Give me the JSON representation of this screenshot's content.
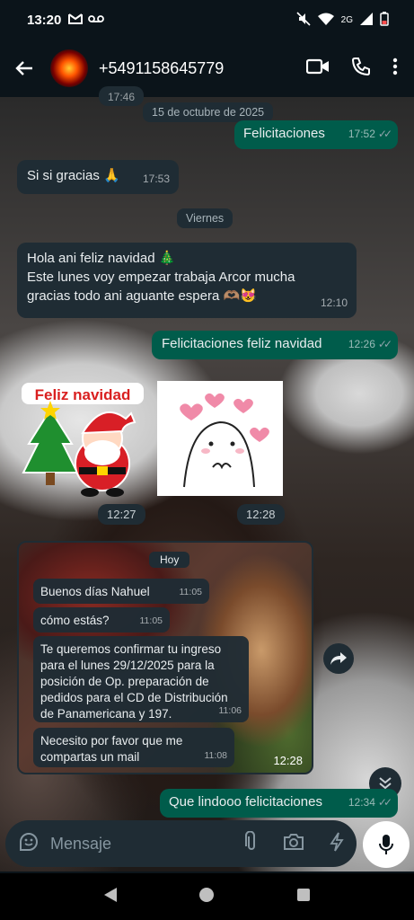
{
  "status_bar": {
    "time": "13:20",
    "network": "2G"
  },
  "header": {
    "contact": "+5491158645779"
  },
  "partial_time": "17:46",
  "date_chips": {
    "d1": "15 de octubre de 2025",
    "d2": "Viernes"
  },
  "messages": {
    "m1": {
      "text": "Felicitaciones",
      "time": "17:52"
    },
    "m2": {
      "text": "Si si gracias 🙏",
      "time": "17:53"
    },
    "m3": {
      "line1": "Hola ani feliz navidad 🎄",
      "line2": "Este lunes voy empezar trabaja Arcor mucha",
      "line3": "gracias todo ani aguante espera 🫶🏽😻",
      "time": "12:10"
    },
    "m4": {
      "text": "Felicitaciones feliz navidad",
      "time": "12:26"
    },
    "sticker1": {
      "caption": "Feliz navidad",
      "time": "12:27"
    },
    "sticker2": {
      "time": "12:28"
    },
    "forwarded": {
      "chip": "Hoy",
      "b1": {
        "text": "Buenos días Nahuel",
        "time": "11:05"
      },
      "b2": {
        "text": "cómo estás?",
        "time": "11:05"
      },
      "b3": {
        "l1": "Te queremos confirmar tu ingreso",
        "l2": "para el lunes 29/12/2025 para la",
        "l3": "posición de Op. preparación de",
        "l4": "pedidos para el CD de Distribución",
        "l5": "de Panamericana y 197.",
        "time": "11:06"
      },
      "b4": {
        "l1": "Necesito por favor que me",
        "l2": "compartas un mail",
        "time": "11:08"
      },
      "time": "12:28"
    },
    "m5": {
      "text": "Que lindooo felicitaciones",
      "time": "12:34"
    }
  },
  "composer": {
    "placeholder": "Mensaje"
  },
  "colors": {
    "incoming": "#1f2c34",
    "outgoing": "#005c4b",
    "accent": "#25d366"
  }
}
